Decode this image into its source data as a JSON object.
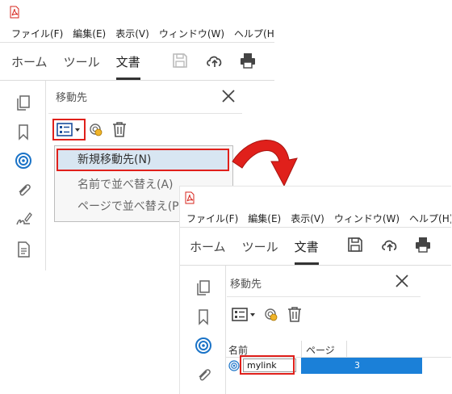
{
  "window1": {
    "menu": [
      "ファイル(F)",
      "編集(E)",
      "表示(V)",
      "ウィンドウ(W)",
      "ヘルプ(H)"
    ],
    "tabs": [
      "ホーム",
      "ツール",
      "文書"
    ],
    "panel_title": "移動先",
    "dropdown": {
      "new_destination": "新規移動先(N)",
      "sort_by_name": "名前で並べ替え(A)",
      "sort_by_page": "ページで並べ替え(P)"
    }
  },
  "window2": {
    "menu": [
      "ファイル(F)",
      "編集(E)",
      "表示(V)",
      "ウィンドウ(W)",
      "ヘルプ(H)"
    ],
    "tabs": [
      "ホーム",
      "ツール",
      "文書"
    ],
    "panel_title": "移動先",
    "table": {
      "col_name": "名前",
      "col_page": "ページ",
      "rows": [
        {
          "name": "mylink",
          "page": "3"
        }
      ]
    }
  },
  "colors": {
    "highlight": "#e0201b",
    "accent": "#1b80d8",
    "active_icon": "#1a73c7",
    "pdf_red": "#d7261e"
  }
}
